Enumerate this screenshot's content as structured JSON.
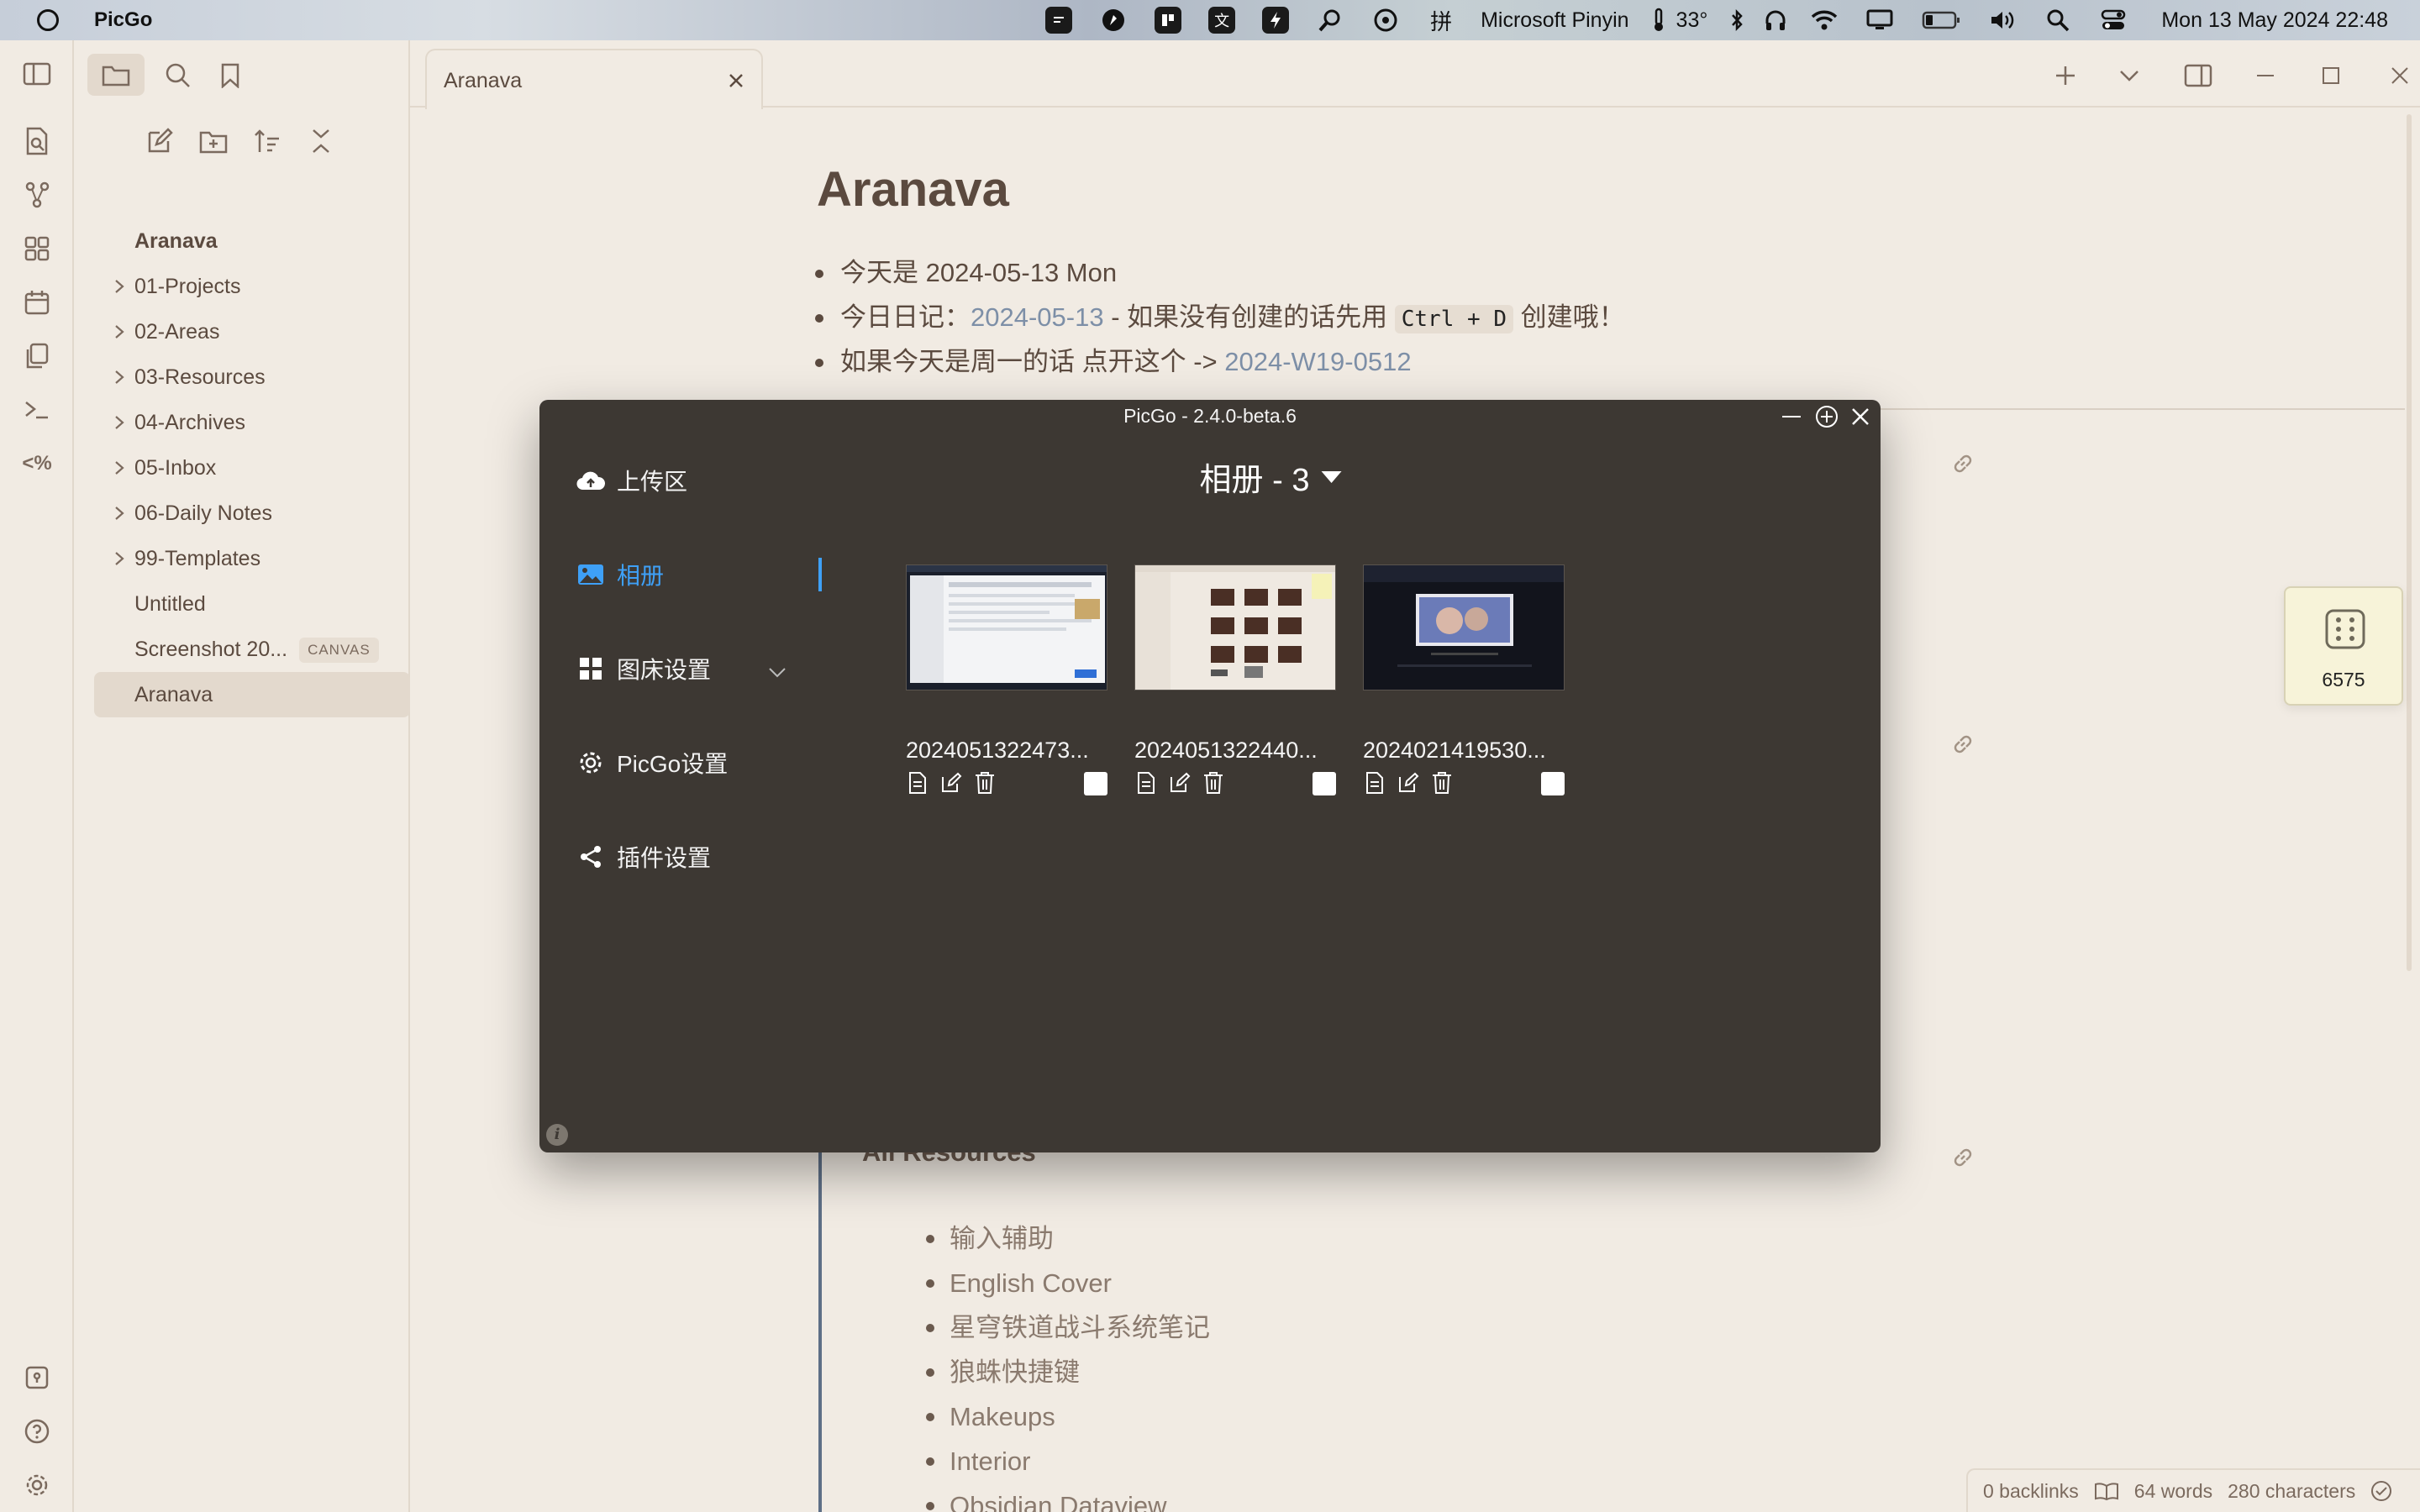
{
  "menubar": {
    "app_name": "PicGo",
    "input_method": "Microsoft Pinyin",
    "temperature": "33°",
    "clock": "Mon 13 May 2024 22:48",
    "glyph_wen": "文",
    "glyph_pin": "拼"
  },
  "explorer": {
    "vault_name": "Aranava",
    "items": [
      {
        "label": "01-Projects",
        "folder": true
      },
      {
        "label": "02-Areas",
        "folder": true
      },
      {
        "label": "03-Resources",
        "folder": true
      },
      {
        "label": "04-Archives",
        "folder": true
      },
      {
        "label": "05-Inbox",
        "folder": true
      },
      {
        "label": "06-Daily Notes",
        "folder": true
      },
      {
        "label": "99-Templates",
        "folder": true
      },
      {
        "label": "Untitled",
        "folder": false
      },
      {
        "label": "Screenshot 20...",
        "folder": false,
        "badge": "CANVAS"
      },
      {
        "label": "Aranava",
        "folder": false,
        "selected": true
      }
    ]
  },
  "tab": {
    "title": "Aranava"
  },
  "note": {
    "title": "Aranava",
    "line1": "今天是 2024-05-13 Mon",
    "line2_prefix": "今日日记：",
    "line2_link": "2024-05-13",
    "line2_mid": " - 如果没有创建的话先用 ",
    "line2_code": "Ctrl + D",
    "line2_suffix": " 创建哦！",
    "line3_prefix": "如果今天是周一的话 点开这个 -> ",
    "line3_link": "2024-W19-0512",
    "section_heading": "All Resources",
    "resources": [
      "输入辅助",
      "English Cover",
      "星穹铁道战斗系统笔记",
      "狼蛛快捷键",
      "Makeups",
      "Interior",
      "Obsidian Dataview"
    ]
  },
  "dice": {
    "value": "6575"
  },
  "status": {
    "backlinks": "0 backlinks",
    "words": "64 words",
    "characters": "280 characters"
  },
  "picgo": {
    "window_title": "PicGo - 2.4.0-beta.6",
    "nav": {
      "upload": "上传区",
      "album": "相册",
      "bed_settings": "图床设置",
      "picgo_settings": "PicGo设置",
      "plugin_settings": "插件设置"
    },
    "album_header": "相册 - 3",
    "images": [
      {
        "name": "2024051322473..."
      },
      {
        "name": "2024051322440..."
      },
      {
        "name": "2024021419530..."
      }
    ],
    "info_glyph": "i"
  },
  "colors": {
    "background": "#f1ebe3",
    "text": "#5b4a3f",
    "link": "#7d8fa7",
    "picgo_bg": "#3d3833",
    "picgo_accent": "#3ea0f7"
  }
}
